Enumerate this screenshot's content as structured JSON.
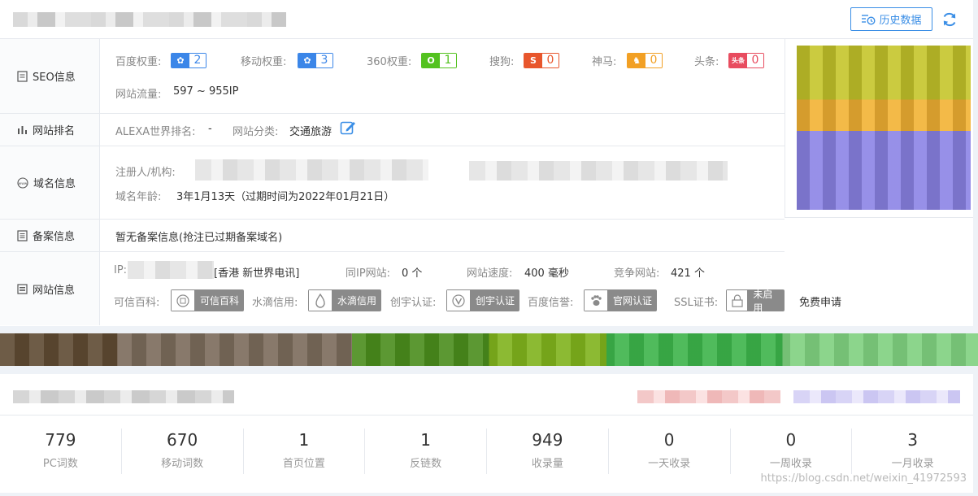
{
  "header": {
    "history_label": "历史数据"
  },
  "labels": {
    "seo": "SEO信息",
    "rank": "网站排名",
    "domain": "域名信息",
    "beian": "备案信息",
    "site": "网站信息"
  },
  "seo": {
    "baidu_label": "百度权重:",
    "baidu_value": "2",
    "mobile_label": "移动权重:",
    "mobile_value": "3",
    "q360_label": "360权重:",
    "q360_value": "1",
    "sogou_label": "搜狗:",
    "sogou_value": "0",
    "shenma_label": "神马:",
    "shenma_value": "0",
    "toutiao_label": "头条:",
    "toutiao_value": "0",
    "traffic_label": "网站流量:",
    "traffic_value": "597 ~ 955IP"
  },
  "rank": {
    "alexa_label": "ALEXA世界排名:",
    "alexa_value": "-",
    "category_label": "网站分类:",
    "category_value": "交通旅游"
  },
  "domain": {
    "registrant_label": "注册人/机构:",
    "age_label": "域名年龄:",
    "age_value": "3年1月13天（过期时间为2022年01月21日）"
  },
  "beian": {
    "text": "暂无备案信息(抢注已过期备案域名)"
  },
  "site": {
    "ip_label": "IP:",
    "ip_location": "[香港 新世界电讯]",
    "sameip_label": "同IP网站:",
    "sameip_value": "0 个",
    "speed_label": "网站速度:",
    "speed_value": "400 毫秒",
    "compete_label": "竞争网站:",
    "compete_value": "421 个",
    "kexin_label": "可信百科:",
    "kexin_badge": "可信百科",
    "shuidi_label": "水滴信用:",
    "shuidi_badge": "水滴信用",
    "chuangyu_label": "创宇认证:",
    "chuangyu_badge": "创宇认证",
    "baiduxy_label": "百度信誉:",
    "baiduxy_badge": "官网认证",
    "ssl_label": "SSL证书:",
    "ssl_badge": "未启用",
    "ssl_link": "免费申请"
  },
  "stats": [
    {
      "value": "779",
      "label": "PC词数"
    },
    {
      "value": "670",
      "label": "移动词数"
    },
    {
      "value": "1",
      "label": "首页位置"
    },
    {
      "value": "1",
      "label": "反链数"
    },
    {
      "value": "949",
      "label": "收录量"
    },
    {
      "value": "0",
      "label": "一天收录"
    },
    {
      "value": "0",
      "label": "一周收录"
    },
    {
      "value": "3",
      "label": "一月收录"
    }
  ],
  "watermark": "https://blog.csdn.net/weixin_41972593",
  "colors": {
    "primary": "#3a8ee6",
    "baidu": "#3b86e8",
    "q360": "#53c21f",
    "sogou": "#e8562c",
    "shenma": "#f2a024",
    "toutiao": "#e84c5f"
  }
}
